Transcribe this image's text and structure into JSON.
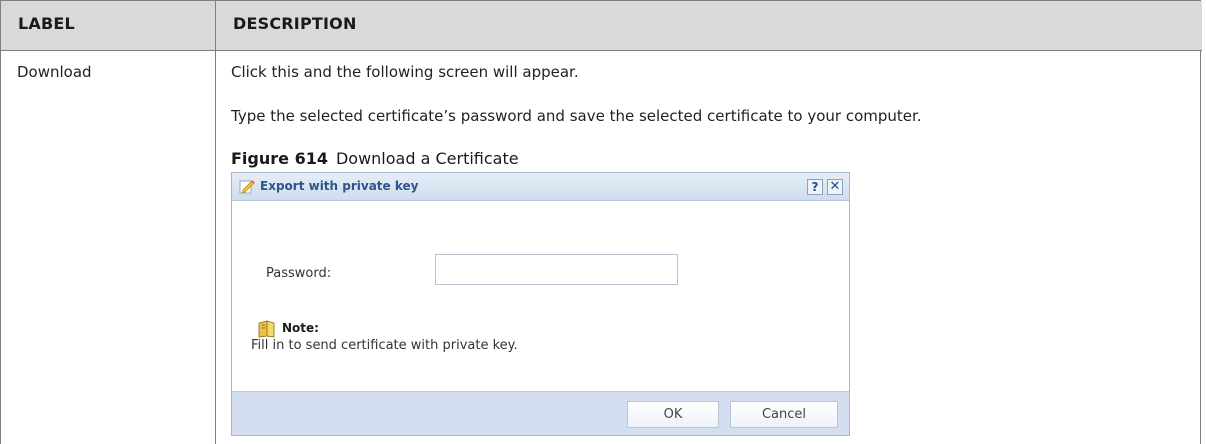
{
  "table": {
    "header_label": "LABEL",
    "header_description": "DESCRIPTION",
    "row_label": "Download",
    "para1": "Click this and the following screen will appear.",
    "para2": "Type the selected certificate’s password and save the selected certificate to your computer.",
    "figure_number": "Figure 614",
    "figure_title": "Download a Certificate"
  },
  "dialog": {
    "title": "Export with private key",
    "title_icon": "pencil-edit-icon",
    "help_label": "?",
    "close_label": "✕",
    "password_label": "Password:",
    "password_value": "",
    "note_icon": "note-book-icon",
    "note_title": "Note:",
    "note_text": "Fill in to send certificate with private key.",
    "ok_label": "OK",
    "cancel_label": "Cancel"
  }
}
